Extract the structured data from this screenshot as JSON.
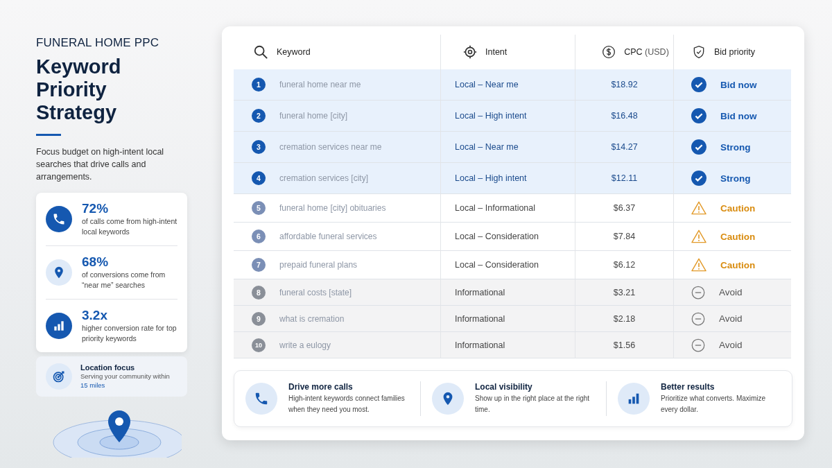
{
  "header": {
    "eyebrow": "FUNERAL HOME PPC",
    "title": "Keyword Priority Strategy",
    "description": "Focus budget on high-intent local searches that drive calls and arrangements."
  },
  "stats": [
    {
      "kind": "phone",
      "value": "72%",
      "text": "of calls come from high-intent local keywords"
    },
    {
      "kind": "pin",
      "value": "68%",
      "text": "of conversions come from “near me” searches"
    },
    {
      "kind": "chart",
      "value": "3.2x",
      "text": "higher conversion rate for top priority keywords"
    }
  ],
  "location": {
    "title": "Location focus",
    "text": "Serving your community within",
    "highlight": "15 miles"
  },
  "table": {
    "columns": [
      {
        "kind": "search",
        "label": "Keyword"
      },
      {
        "kind": "target",
        "label": "Intent"
      },
      {
        "kind": "dollar",
        "label": "CPC",
        "unit": "(USD)"
      },
      {
        "kind": "shield",
        "label": "Bid priority"
      }
    ],
    "rows": [
      {
        "rank": "1",
        "keyword": "funeral home near me",
        "intent": "Local – Near me",
        "cpc": "$18.92",
        "kind": "go",
        "priority": "Bid now"
      },
      {
        "rank": "2",
        "keyword": "funeral home [city]",
        "intent": "Local – High intent",
        "cpc": "$16.48",
        "kind": "go",
        "priority": "Bid now"
      },
      {
        "rank": "3",
        "keyword": "cremation services near me",
        "intent": "Local – Near me",
        "cpc": "$14.27",
        "kind": "go",
        "priority": "Strong"
      },
      {
        "rank": "4",
        "keyword": "cremation services [city]",
        "intent": "Local – High intent",
        "cpc": "$12.11",
        "kind": "go",
        "priority": "Strong"
      },
      {
        "rank": "5",
        "keyword": "funeral home [city] obituaries",
        "intent": "Local – Informational",
        "cpc": "$6.37",
        "kind": "caution",
        "priority": "Caution"
      },
      {
        "rank": "6",
        "keyword": "affordable funeral services",
        "intent": "Local – Consideration",
        "cpc": "$7.84",
        "kind": "caution",
        "priority": "Caution"
      },
      {
        "rank": "7",
        "keyword": "prepaid funeral plans",
        "intent": "Local – Consideration",
        "cpc": "$6.12",
        "kind": "caution",
        "priority": "Caution"
      },
      {
        "rank": "8",
        "keyword": "funeral costs [state]",
        "intent": "Informational",
        "cpc": "$3.21",
        "kind": "avoid",
        "priority": "Avoid"
      },
      {
        "rank": "9",
        "keyword": "what is cremation",
        "intent": "Informational",
        "cpc": "$2.18",
        "kind": "avoid",
        "priority": "Avoid"
      },
      {
        "rank": "10",
        "keyword": "write a eulogy",
        "intent": "Informational",
        "cpc": "$1.56",
        "kind": "avoid",
        "priority": "Avoid"
      }
    ]
  },
  "benefits": [
    {
      "kind": "phone",
      "title": "Drive more calls",
      "text": "High-intent keywords connect families when they need you most."
    },
    {
      "kind": "pin",
      "title": "Local visibility",
      "text": "Show up in the right place at the right time."
    },
    {
      "kind": "chart",
      "title": "Better results",
      "text": "Prioritize what converts. Maximize every dollar."
    }
  ]
}
